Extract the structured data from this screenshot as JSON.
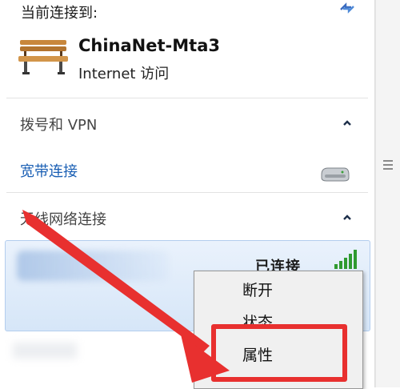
{
  "current_connection": {
    "label": "当前连接到:",
    "network_name": "ChinaNet-Mta3",
    "access": "Internet 访问"
  },
  "dialup_section": {
    "title": "拨号和 VPN",
    "broadband_label": "宽带连接"
  },
  "wireless_section": {
    "title": "无线网络连接",
    "status": "已连接"
  },
  "context_menu": {
    "items": [
      "断开",
      "状态",
      "属性"
    ]
  },
  "colors": {
    "annotation_red": "#e8302f",
    "link_blue": "#1a5fb4",
    "selection_blue": "#d6e6f8",
    "signal_green": "#2f9a2f"
  },
  "icons": {
    "refresh": "refresh-icon",
    "network": "bench-icon",
    "modem": "modem-icon",
    "signal": "signal-strength-icon"
  }
}
